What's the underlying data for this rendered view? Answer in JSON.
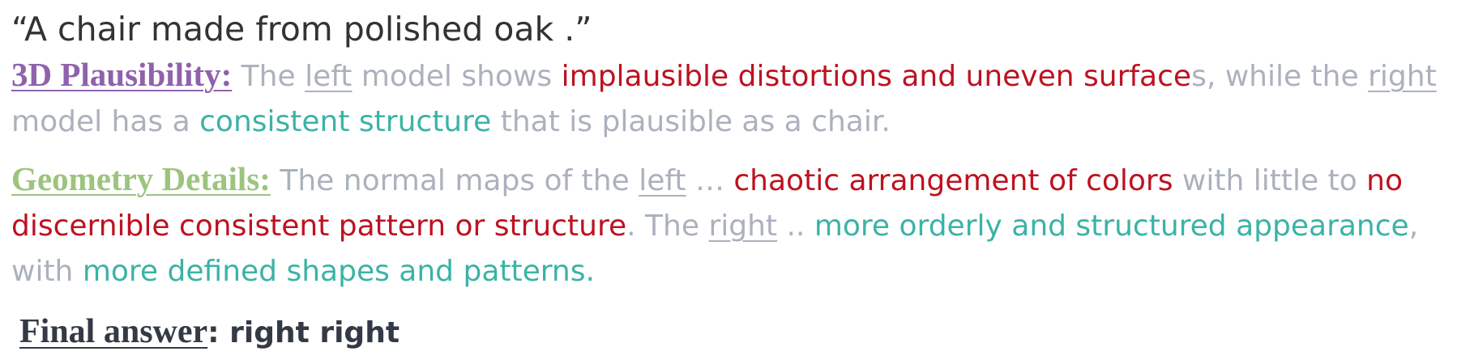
{
  "prompt": "“A chair made from polished oak .”",
  "plausibility": {
    "heading": "3D Plausibility:",
    "t1": " The ",
    "left": "left",
    "t2": " model shows ",
    "red1": "implausible distortions and uneven surface",
    "t3": "s, while the ",
    "right": "right",
    "t4": " model has a ",
    "teal1": "consistent structure",
    "t5": " that is plausible as a chair."
  },
  "geometry": {
    "heading": "Geometry Details:",
    "t1": " The normal maps of the ",
    "left": "left",
    "t2": "  … ",
    "red1": "chaotic arrangement of colors",
    "t3": " with little to ",
    "red2": "no discernible consistent pattern or structure",
    "t4": ". The ",
    "right": "right",
    "t5": " .. ",
    "teal1": "more orderly and structured appearance",
    "t6": ", with ",
    "teal2": "more defined shapes and patterns."
  },
  "final": {
    "label": "Final answer",
    "value": ": right right"
  },
  "colors": {
    "heading_plausibility": "#9062ab",
    "heading_geometry": "#9cc47e",
    "negative": "#bd1220",
    "positive": "#3bb3a6",
    "neutral": "#abb1bd"
  }
}
